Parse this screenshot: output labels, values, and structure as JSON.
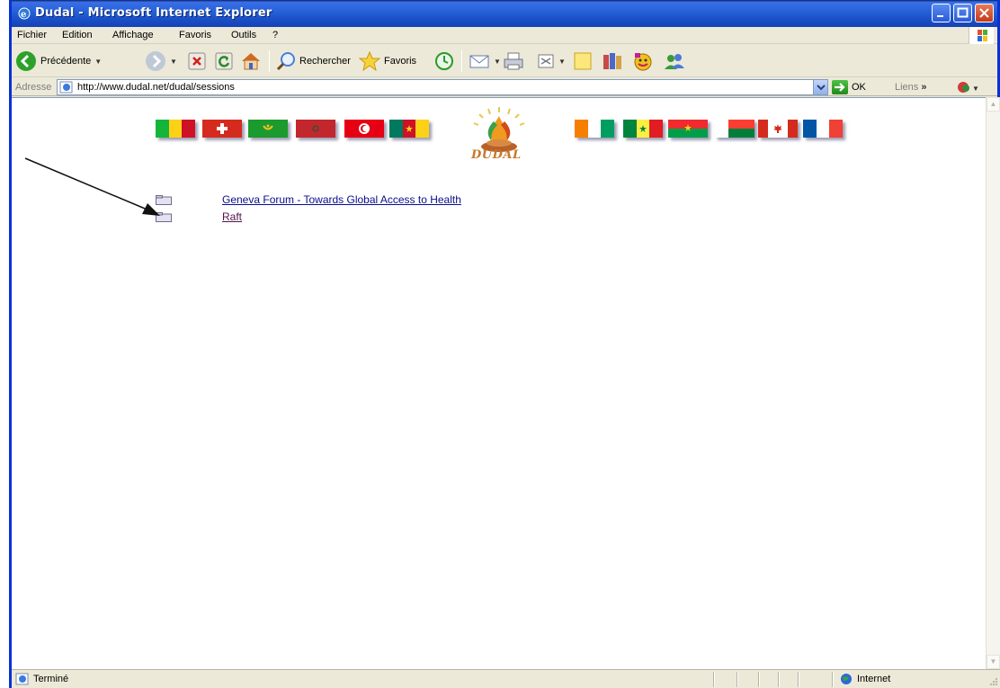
{
  "window": {
    "title": "Dudal - Microsoft Internet Explorer",
    "minimize_icon": "minimize-icon",
    "maximize_icon": "maximize-icon",
    "close_icon": "close-icon"
  },
  "menubar": {
    "items": [
      "Fichier",
      "Edition",
      "Affichage",
      "Favoris",
      "Outils",
      "?"
    ]
  },
  "toolbar": {
    "back_label": "Précédente",
    "search_label": "Rechercher",
    "favorites_label": "Favoris"
  },
  "addressbar": {
    "label": "Adresse",
    "url": "http://www.dudal.net/dudal/sessions",
    "go_label": "OK",
    "links_label": "Liens"
  },
  "page": {
    "logo_text": "DUDAL",
    "links": [
      {
        "label": "Geneva Forum - Towards Global Access to Health"
      },
      {
        "label": "Raft"
      }
    ]
  },
  "statusbar": {
    "status": "Terminé",
    "zone": "Internet"
  },
  "colors": {
    "titlebar": "#2763d8",
    "link": "#0a0d8a",
    "visited_link": "#55124a",
    "chrome": "#ece9d8"
  }
}
